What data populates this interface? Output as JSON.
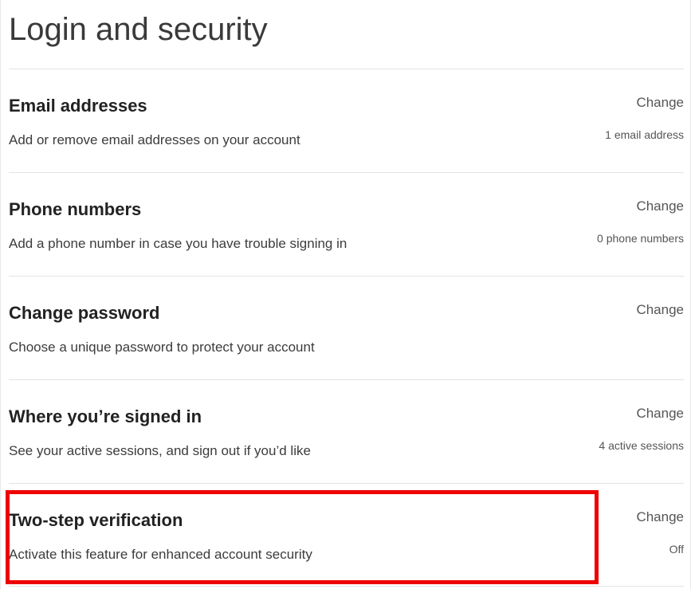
{
  "page": {
    "title": "Login and security"
  },
  "sections": [
    {
      "heading": "Email addresses",
      "description": "Add or remove email addresses on your account",
      "action_label": "Change",
      "status": "1 email address"
    },
    {
      "heading": "Phone numbers",
      "description": "Add a phone number in case you have trouble signing in",
      "action_label": "Change",
      "status": "0 phone numbers"
    },
    {
      "heading": "Change password",
      "description": "Choose a unique password to protect your account",
      "action_label": "Change",
      "status": ""
    },
    {
      "heading": "Where you’re signed in",
      "description": "See your active sessions, and sign out if you’d like",
      "action_label": "Change",
      "status": "4 active sessions"
    },
    {
      "heading": "Two-step verification",
      "description": "Activate this feature for enhanced account security",
      "action_label": "Change",
      "status": "Off"
    }
  ],
  "colors": {
    "highlight": "#ee0000",
    "divider": "#e3e3e3"
  }
}
